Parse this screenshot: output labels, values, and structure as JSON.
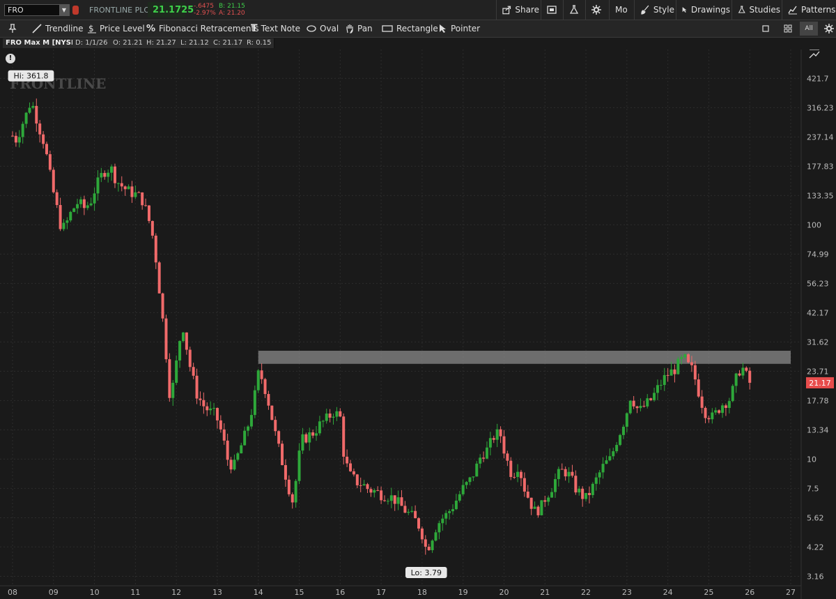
{
  "header": {
    "symbol": "FRO",
    "company": "FRONTLINE PLC",
    "last_price": "21.1725",
    "net_change": "-.6475",
    "pct_change": "-2.97%",
    "bid": "B: 21.15",
    "ask": "A: 21.20",
    "buttons": {
      "share": "Share",
      "mo": "Mo",
      "style": "Style",
      "drawings": "Drawings",
      "studies": "Studies",
      "patterns": "Patterns"
    }
  },
  "drawing_tools": {
    "trendline": "Trendline",
    "price_level": "Price Level",
    "fibonacci": "Fibonacci Retracements",
    "text_note": "Text Note",
    "oval": "Oval",
    "pan": "Pan",
    "rectangle": "Rectangle",
    "pointer": "Pointer",
    "view_all": "All"
  },
  "chart_info": {
    "title": "FRO Max M [NYSE]",
    "date": "D: 1/1/26",
    "open": "O: 21.21",
    "high": "H: 21.27",
    "low": "L: 21.12",
    "close": "C: 21.17",
    "range": "R: 0.15"
  },
  "watermark": "FRONTLINE",
  "colors": {
    "up": "#2ea83a",
    "down": "#f06a6a",
    "background": "#1a1a1a",
    "grid": "#2c2c2c",
    "price_tag": "#e84c4c"
  },
  "chart_data": {
    "type": "candlestick",
    "x_axis_labels": [
      "08",
      "09",
      "10",
      "11",
      "12",
      "13",
      "14",
      "15",
      "16",
      "17",
      "18",
      "19",
      "20",
      "21",
      "22",
      "23",
      "24",
      "25",
      "26",
      "27"
    ],
    "y_axis_labels": [
      "421.7",
      "316.23",
      "237.14",
      "177.83",
      "133.35",
      "100",
      "74.99",
      "56.23",
      "42.17",
      "31.62",
      "23.71",
      "17.78",
      "13.34",
      "10",
      "7.5",
      "5.62",
      "4.22",
      "3.16"
    ],
    "y_scale": "log",
    "ylim": [
      2.9,
      560
    ],
    "current_price": "21.17",
    "high_label": "Hi: 361.8",
    "low_label": "Lo: 3.79",
    "high_value": 361.8,
    "low_value": 3.79,
    "resistance_zone": {
      "low": 25.5,
      "high": 29.0,
      "from_year": 2014.0,
      "to_year": 2027.0
    },
    "close_path": [
      [
        2008.0,
        240
      ],
      [
        2008.1,
        230
      ],
      [
        2008.2,
        260
      ],
      [
        2008.35,
        300
      ],
      [
        2008.45,
        340
      ],
      [
        2008.55,
        300
      ],
      [
        2008.65,
        260
      ],
      [
        2008.75,
        230
      ],
      [
        2008.85,
        190
      ],
      [
        2008.95,
        150
      ],
      [
        2009.05,
        125
      ],
      [
        2009.2,
        95
      ],
      [
        2009.3,
        100
      ],
      [
        2009.45,
        115
      ],
      [
        2009.6,
        125
      ],
      [
        2009.75,
        118
      ],
      [
        2009.9,
        125
      ],
      [
        2010.0,
        140
      ],
      [
        2010.15,
        160
      ],
      [
        2010.25,
        170
      ],
      [
        2010.4,
        175
      ],
      [
        2010.5,
        160
      ],
      [
        2010.6,
        150
      ],
      [
        2010.8,
        140
      ],
      [
        2011.0,
        135
      ],
      [
        2011.15,
        130
      ],
      [
        2011.3,
        110
      ],
      [
        2011.45,
        85
      ],
      [
        2011.55,
        60
      ],
      [
        2011.65,
        42
      ],
      [
        2011.75,
        28
      ],
      [
        2011.85,
        18
      ],
      [
        2011.95,
        22
      ],
      [
        2012.05,
        30
      ],
      [
        2012.15,
        38
      ],
      [
        2012.25,
        30
      ],
      [
        2012.35,
        24
      ],
      [
        2012.5,
        19
      ],
      [
        2012.65,
        17
      ],
      [
        2012.8,
        16
      ],
      [
        2012.95,
        15.5
      ],
      [
        2013.05,
        14
      ],
      [
        2013.15,
        12
      ],
      [
        2013.25,
        10
      ],
      [
        2013.4,
        9.2
      ],
      [
        2013.55,
        11
      ],
      [
        2013.7,
        13
      ],
      [
        2013.8,
        15
      ],
      [
        2013.9,
        18
      ],
      [
        2014.0,
        23
      ],
      [
        2014.1,
        22
      ],
      [
        2014.2,
        19
      ],
      [
        2014.3,
        16
      ],
      [
        2014.45,
        12
      ],
      [
        2014.6,
        9.5
      ],
      [
        2014.75,
        7.5
      ],
      [
        2014.85,
        6.5
      ],
      [
        2014.95,
        9
      ],
      [
        2015.05,
        12
      ],
      [
        2015.2,
        12.5
      ],
      [
        2015.35,
        13
      ],
      [
        2015.5,
        14
      ],
      [
        2015.7,
        15
      ],
      [
        2015.85,
        16
      ],
      [
        2016.0,
        15
      ],
      [
        2016.1,
        10
      ],
      [
        2016.25,
        8.5
      ],
      [
        2016.4,
        8.0
      ],
      [
        2016.55,
        7.8
      ],
      [
        2016.7,
        7.4
      ],
      [
        2016.85,
        7.3
      ],
      [
        2017.0,
        7.1
      ],
      [
        2017.15,
        7.0
      ],
      [
        2017.3,
        6.8
      ],
      [
        2017.45,
        6.4
      ],
      [
        2017.6,
        6.0
      ],
      [
        2017.75,
        5.7
      ],
      [
        2017.9,
        5.3
      ],
      [
        2018.0,
        4.8
      ],
      [
        2018.1,
        4.1
      ],
      [
        2018.2,
        4.4
      ],
      [
        2018.3,
        5.0
      ],
      [
        2018.45,
        5.5
      ],
      [
        2018.6,
        5.8
      ],
      [
        2018.75,
        6.3
      ],
      [
        2018.9,
        7.0
      ],
      [
        2019.0,
        7.5
      ],
      [
        2019.15,
        8.0
      ],
      [
        2019.3,
        9.0
      ],
      [
        2019.45,
        10.5
      ],
      [
        2019.6,
        11
      ],
      [
        2019.75,
        12.5
      ],
      [
        2019.9,
        13
      ],
      [
        2020.0,
        11
      ],
      [
        2020.1,
        9.5
      ],
      [
        2020.2,
        8.5
      ],
      [
        2020.35,
        9.5
      ],
      [
        2020.5,
        7.5
      ],
      [
        2020.65,
        6.5
      ],
      [
        2020.75,
        6.0
      ],
      [
        2020.9,
        6.2
      ],
      [
        2021.0,
        6.8
      ],
      [
        2021.15,
        7.5
      ],
      [
        2021.3,
        8.5
      ],
      [
        2021.45,
        9.0
      ],
      [
        2021.6,
        8.5
      ],
      [
        2021.75,
        7.5
      ],
      [
        2021.9,
        7.0
      ],
      [
        2022.0,
        6.8
      ],
      [
        2022.15,
        7.5
      ],
      [
        2022.3,
        8.5
      ],
      [
        2022.45,
        9.5
      ],
      [
        2022.6,
        10
      ],
      [
        2022.75,
        12
      ],
      [
        2022.9,
        14
      ],
      [
        2023.0,
        16
      ],
      [
        2023.1,
        19
      ],
      [
        2023.2,
        17
      ],
      [
        2023.3,
        16
      ],
      [
        2023.45,
        17
      ],
      [
        2023.6,
        18
      ],
      [
        2023.75,
        20
      ],
      [
        2023.9,
        22
      ],
      [
        2024.0,
        23
      ],
      [
        2024.15,
        24
      ],
      [
        2024.3,
        26
      ],
      [
        2024.4,
        27
      ],
      [
        2024.5,
        25
      ],
      [
        2024.6,
        24
      ],
      [
        2024.7,
        21
      ],
      [
        2024.8,
        18
      ],
      [
        2024.9,
        16
      ],
      [
        2025.0,
        15.5
      ],
      [
        2025.1,
        15
      ],
      [
        2025.2,
        16
      ],
      [
        2025.3,
        17
      ],
      [
        2025.4,
        17.5
      ],
      [
        2025.5,
        18
      ],
      [
        2025.6,
        20
      ],
      [
        2025.7,
        23
      ],
      [
        2025.8,
        25
      ],
      [
        2025.9,
        23
      ],
      [
        2026.0,
        21.17
      ]
    ]
  }
}
